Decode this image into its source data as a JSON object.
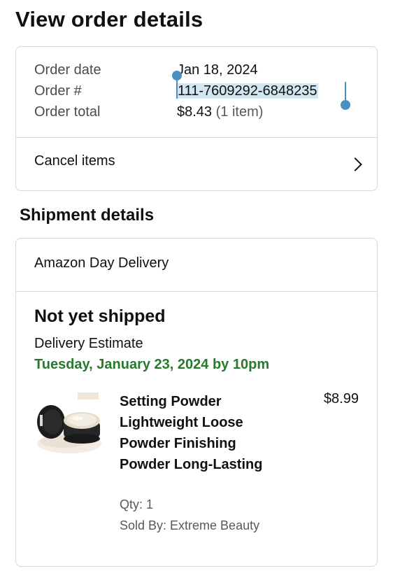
{
  "page": {
    "title": "View order details"
  },
  "summary": {
    "order_date_label": "Order date",
    "order_date_value": "Jan 18, 2024",
    "order_number_label": "Order #",
    "order_number_value": "111-7609292-6848235",
    "order_total_label": "Order total",
    "order_total_value": "$8.43",
    "order_total_items": "(1 item)",
    "cancel_label": "Cancel items"
  },
  "shipment": {
    "section_title": "Shipment details",
    "delivery_type": "Amazon Day Delivery",
    "status": "Not yet shipped",
    "estimate_label": "Delivery Estimate",
    "estimate_date": "Tuesday, January 23, 2024 by 10pm",
    "item": {
      "title": "Setting Powder Lightweight Loose Powder Finishing Powder Long-Lasting",
      "price": "$8.99",
      "qty": "Qty: 1",
      "sold_by": "Sold By: Extreme Beauty",
      "image_icon": "cosmetic-powder-jar-image"
    }
  },
  "colors": {
    "delivery_green": "#277a2b",
    "selection_blue": "#4a8fc2",
    "selection_bg": "#d2e6f2",
    "border": "#d5d9d9"
  }
}
